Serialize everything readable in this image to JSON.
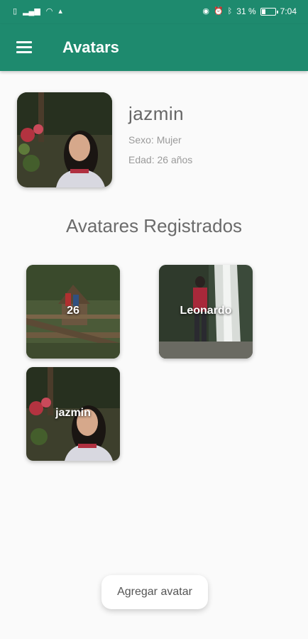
{
  "status_bar": {
    "left_icons": [
      "sim-icon",
      "signal-icon",
      "wifi-icon",
      "notification-icon"
    ],
    "right_icons": [
      "eye-icon",
      "alarm-icon",
      "bluetooth-icon"
    ],
    "battery_text": "31 %",
    "battery_level": 0.31,
    "time": "7:04"
  },
  "app_bar": {
    "title": "Avatars",
    "menu_icon": "menu-icon"
  },
  "profile": {
    "name": "jazmin",
    "sexo": "Sexo: Mujer",
    "edad": "Edad: 26 años"
  },
  "section_title": "Avatares Registrados",
  "avatars": [
    {
      "label": "26"
    },
    {
      "label": "Leonardo"
    },
    {
      "label": "jazmin"
    }
  ],
  "add_button": "Agregar avatar",
  "colors": {
    "primary": "#1e8a6e",
    "background": "#fafafa",
    "text_muted": "#9a9a9a"
  }
}
